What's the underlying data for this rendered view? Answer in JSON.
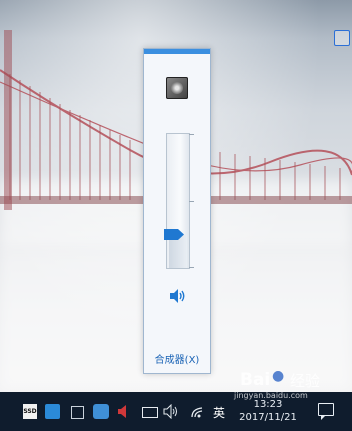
{
  "volume_flyout": {
    "device_icon": "speaker-device-icon",
    "volume_level": 0.25,
    "speaker_icon": "speaker-volume-icon",
    "mixer_label": "合成器(X)"
  },
  "taskbar": {
    "tray_icons": [
      "ssd-icon",
      "wave-app-icon",
      "square-app-icon",
      "cloud-app-icon",
      "red-speaker-app-icon",
      "battery-icon",
      "volume-icon",
      "wifi-icon"
    ],
    "ssd_label": "SSD",
    "language": "英",
    "clock_time": "13:23",
    "clock_date": "2017/11/21",
    "notification_icon": "action-center-icon"
  },
  "watermark": {
    "brand_left": "Bai",
    "brand_right": "经验",
    "url": "jingyan.baidu.com"
  },
  "colors": {
    "accent": "#1f78d1",
    "taskbar": "#0f1c2d",
    "bridge": "#b5505a"
  }
}
